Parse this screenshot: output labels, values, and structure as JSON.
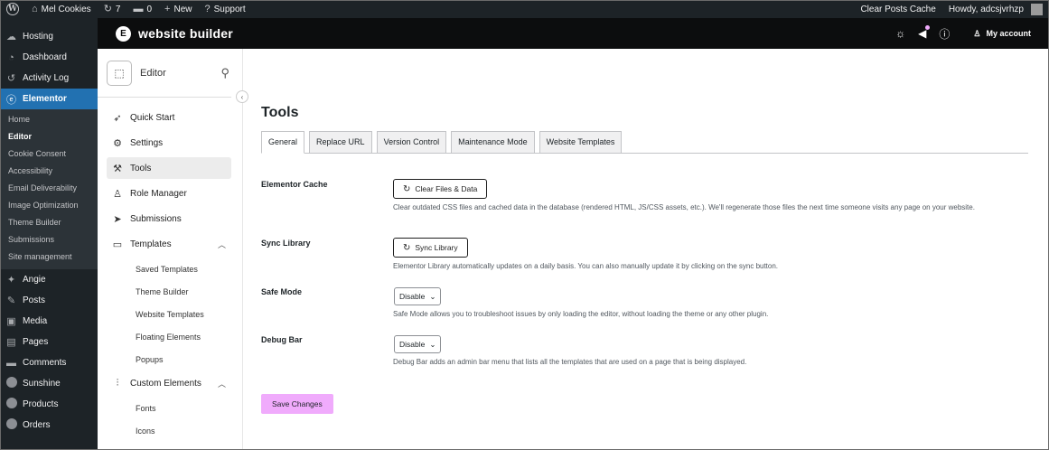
{
  "admin_bar": {
    "site_name": "Mel Cookies",
    "updates_count": "7",
    "comments_count": "0",
    "new_label": "New",
    "support_label": "Support",
    "clear_cache_label": "Clear Posts Cache",
    "howdy": "Howdy, adcsjvrhzp"
  },
  "wp_menu": {
    "top_items": [
      {
        "label": "Hosting",
        "icon": "cloud-icon"
      },
      {
        "label": "Dashboard",
        "icon": "dashboard-icon"
      },
      {
        "label": "Activity Log",
        "icon": "history-icon"
      },
      {
        "label": "Elementor",
        "icon": "elementor-icon"
      }
    ],
    "elementor_sub": [
      "Home",
      "Editor",
      "Cookie Consent",
      "Accessibility",
      "Email Deliverability",
      "Image Optimization",
      "Theme Builder",
      "Submissions",
      "Site management"
    ],
    "bottom_items": [
      {
        "label": "Angie",
        "icon": "sparkle-icon"
      },
      {
        "label": "Posts",
        "icon": "pin-icon"
      },
      {
        "label": "Media",
        "icon": "media-icon"
      },
      {
        "label": "Pages",
        "icon": "pages-icon"
      },
      {
        "label": "Comments",
        "icon": "comment-icon"
      },
      {
        "label": "Sunshine",
        "icon": "circle-icon"
      },
      {
        "label": "Products",
        "icon": "circle-icon"
      },
      {
        "label": "Orders",
        "icon": "circle-icon"
      }
    ]
  },
  "elementor_bar": {
    "title": "website builder",
    "my_account": "My account"
  },
  "editor_panel": {
    "header_label": "Editor",
    "nav": [
      {
        "label": "Quick Start",
        "icon": "rocket-icon"
      },
      {
        "label": "Settings",
        "icon": "gear-icon"
      },
      {
        "label": "Tools",
        "icon": "wrench-icon"
      },
      {
        "label": "Role Manager",
        "icon": "users-icon"
      },
      {
        "label": "Submissions",
        "icon": "send-icon"
      },
      {
        "label": "Templates",
        "icon": "folder-icon"
      }
    ],
    "templates_sub": [
      "Saved Templates",
      "Theme Builder",
      "Website Templates",
      "Floating Elements",
      "Popups"
    ],
    "custom_elements_label": "Custom Elements",
    "custom_sub": [
      "Fonts",
      "Icons"
    ]
  },
  "tools": {
    "title": "Tools",
    "tabs": [
      "General",
      "Replace URL",
      "Version Control",
      "Maintenance Mode",
      "Website Templates"
    ],
    "cache": {
      "label": "Elementor Cache",
      "button": "Clear Files & Data",
      "desc": "Clear outdated CSS files and cached data in the database (rendered HTML, JS/CSS assets, etc.). We'll regenerate those files the next time someone visits any page on your website."
    },
    "sync": {
      "label": "Sync Library",
      "button": "Sync Library",
      "desc": "Elementor Library automatically updates on a daily basis. You can also manually update it by clicking on the sync button."
    },
    "safe_mode": {
      "label": "Safe Mode",
      "value": "Disable",
      "desc": "Safe Mode allows you to troubleshoot issues by only loading the editor, without loading the theme or any other plugin."
    },
    "debug_bar": {
      "label": "Debug Bar",
      "value": "Disable",
      "desc": "Debug Bar adds an admin bar menu that lists all the templates that are used on a page that is being displayed."
    },
    "save_label": "Save Changes"
  },
  "colors": {
    "admin_dark": "#1d2327",
    "wp_active": "#2271b1",
    "elementor_top": "#0c0d0e",
    "save_pink": "#f0abfc"
  }
}
